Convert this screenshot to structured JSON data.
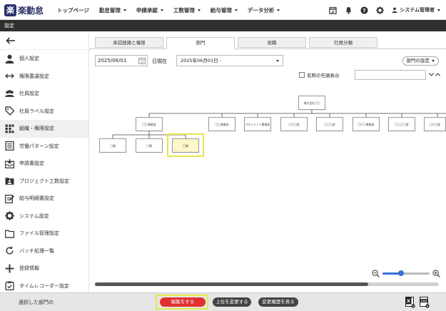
{
  "app": {
    "logo_mark": "楽",
    "logo_text": "楽勤怠"
  },
  "nav": [
    {
      "label": "トップページ",
      "has_menu": false
    },
    {
      "label": "勤怠管理",
      "has_menu": true
    },
    {
      "label": "申請承認",
      "has_menu": true
    },
    {
      "label": "工数管理",
      "has_menu": true
    },
    {
      "label": "給与管理",
      "has_menu": true
    },
    {
      "label": "データ分析",
      "has_menu": true
    }
  ],
  "header_icons": [
    "calendar-check-icon",
    "bell-icon",
    "help-icon",
    "gear-icon"
  ],
  "user": {
    "label": "システム管理者",
    "icon": "person-icon"
  },
  "title_bar": "設定",
  "sidebar": {
    "back_icon": "back-arrow-icon",
    "items": [
      {
        "label": "個人設定",
        "icon": "person-icon",
        "active": false
      },
      {
        "label": "権限委譲設定",
        "icon": "swap-arrows-icon",
        "active": false
      },
      {
        "label": "社員設定",
        "icon": "people-icon",
        "active": false
      },
      {
        "label": "社員ラベル設定",
        "icon": "tag-icon",
        "active": false
      },
      {
        "label": "組織・権限設定",
        "icon": "grid-list-icon",
        "active": true
      },
      {
        "label": "労働パターン設定",
        "icon": "list-icon",
        "active": false
      },
      {
        "label": "申請書設定",
        "icon": "inbox-icon",
        "active": false
      },
      {
        "label": "プロジェクト工数設定",
        "icon": "folder-people-icon",
        "active": false
      },
      {
        "label": "給与明細書設定",
        "icon": "edit-doc-icon",
        "active": false
      },
      {
        "label": "システム設定",
        "icon": "gear-icon",
        "active": false
      },
      {
        "label": "ファイル管理設定",
        "icon": "folder-icon",
        "active": false
      },
      {
        "label": "バッチ処理一覧",
        "icon": "refresh-icon",
        "active": false
      },
      {
        "label": "登録情報",
        "icon": "plus-icon",
        "active": false
      },
      {
        "label": "タイムレコーダー設定",
        "icon": "clipboard-icon",
        "active": false
      }
    ]
  },
  "tabs": [
    {
      "label": "承認経路と権限",
      "active": false
    },
    {
      "label": "部門",
      "active": true
    },
    {
      "label": "役職",
      "active": false
    },
    {
      "label": "社員分類",
      "active": false
    }
  ],
  "filters": {
    "date_value": "2025/06/01",
    "as_of_label": "日現在",
    "period_value": "2025年06月01日 -",
    "dept_settings_label": "部門の設定",
    "prefix_checkbox_label": "名称の先頭表示",
    "prefix_checked": false,
    "search_value": ""
  },
  "org_chart": {
    "root": "株式会社〇〇",
    "level1": [
      "〇〇事業部",
      "〇〇事業部",
      "マネジメント事業部",
      "〇〇〇部",
      "〇〇〇部",
      "〇〇〇事業部",
      "〇〇〇〇部",
      "〇〇〇部"
    ],
    "level2": [
      "〇課",
      "〇課",
      "〇課"
    ],
    "selected": "level2.2"
  },
  "zoom": {
    "level": 0.3
  },
  "scroll": {
    "position": 0.8
  },
  "footer": {
    "selected_label": "選択した部門の",
    "edit_button": "編集をする",
    "change_parent_button": "上位を変更する",
    "history_button": "変更履歴を見る"
  },
  "colors": {
    "primary": "#2a2f6a",
    "danger": "#e03030",
    "highlight": "#e3e84a",
    "selected_node": "#fdf7c9",
    "zoom": "#3a6fd8"
  }
}
